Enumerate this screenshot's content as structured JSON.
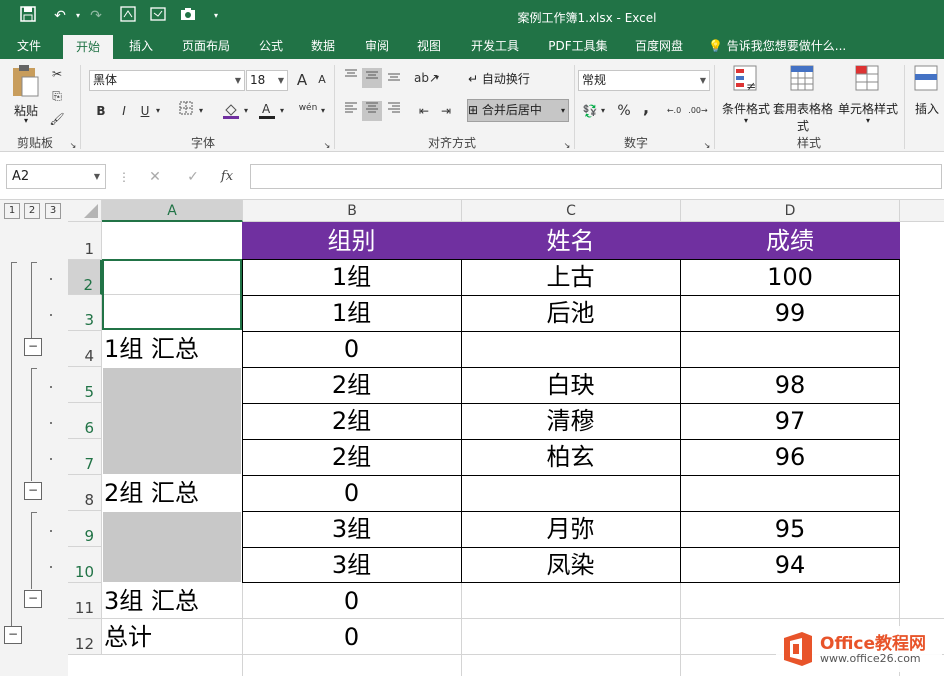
{
  "window": {
    "title": "案例工作簿1.xlsx - Excel"
  },
  "ribbon_tabs": [
    "文件",
    "开始",
    "插入",
    "页面布局",
    "公式",
    "数据",
    "审阅",
    "视图",
    "开发工具",
    "PDF工具集",
    "百度网盘"
  ],
  "tell_me": "告诉我您想要做什么...",
  "ribbon": {
    "clipboard": {
      "paste": "粘贴",
      "label": "剪贴板"
    },
    "font": {
      "name": "黑体",
      "size": "18",
      "bold": "B",
      "italic": "I",
      "underline": "U",
      "grow": "A",
      "shrink": "A",
      "label": "字体",
      "pinyin": "wén"
    },
    "alignment": {
      "wrap": "自动换行",
      "merge": "合并后居中",
      "label": "对齐方式"
    },
    "number": {
      "format": "常规",
      "percent": "%",
      "comma": ",",
      "label": "数字"
    },
    "styles": {
      "conditional": "条件格式",
      "table": "套用表格格式",
      "cell": "单元格样式",
      "label": "样式"
    },
    "cells": {
      "insert": "插入"
    }
  },
  "formula": {
    "namebox": "A2",
    "fx": "fx",
    "cancel": "✕",
    "enter": "✓",
    "value": ""
  },
  "outline_levels": [
    "1",
    "2",
    "3"
  ],
  "columns": [
    "A",
    "B",
    "C",
    "D"
  ],
  "rows": [
    "1",
    "2",
    "3",
    "4",
    "5",
    "6",
    "7",
    "8",
    "9",
    "10",
    "11",
    "12"
  ],
  "header_color": "#7030a0",
  "sheet": {
    "headers": [
      "组别",
      "姓名",
      "成绩"
    ],
    "data": [
      {
        "a": "",
        "b": "1组",
        "c": "上古",
        "d": "100"
      },
      {
        "a": "",
        "b": "1组",
        "c": "后池",
        "d": "99"
      },
      {
        "a": "1组 汇总",
        "b": "0",
        "c": "",
        "d": ""
      },
      {
        "a": "",
        "b": "2组",
        "c": "白玦",
        "d": "98"
      },
      {
        "a": "",
        "b": "2组",
        "c": "清穆",
        "d": "97"
      },
      {
        "a": "",
        "b": "2组",
        "c": "柏玄",
        "d": "96"
      },
      {
        "a": "2组 汇总",
        "b": "0",
        "c": "",
        "d": ""
      },
      {
        "a": "",
        "b": "3组",
        "c": "月弥",
        "d": "95"
      },
      {
        "a": "",
        "b": "3组",
        "c": "凤染",
        "d": "94"
      },
      {
        "a": "3组 汇总",
        "b": "0",
        "c": "",
        "d": ""
      },
      {
        "a": "总计",
        "b": "0",
        "c": "",
        "d": ""
      }
    ]
  },
  "watermark": {
    "brand": "Office教程网",
    "url": "www.office26.com"
  }
}
